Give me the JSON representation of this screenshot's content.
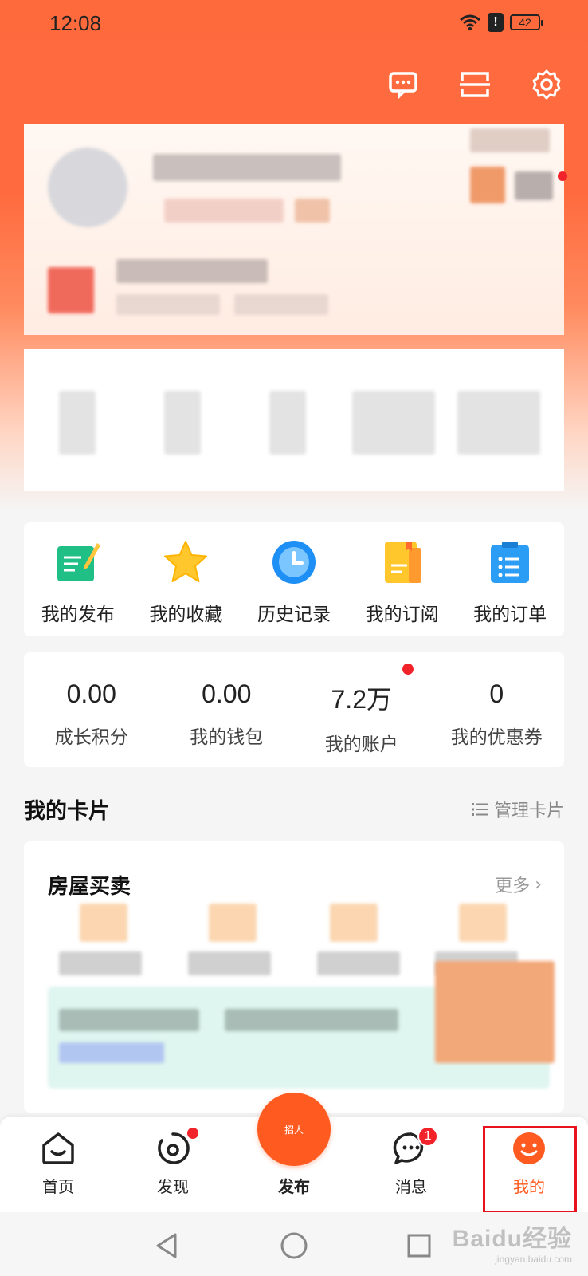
{
  "status_bar": {
    "time": "12:08",
    "alert": "!",
    "battery": "42"
  },
  "quick_actions": [
    {
      "label": "我的发布",
      "icon": "edit-document-icon"
    },
    {
      "label": "我的收藏",
      "icon": "star-icon"
    },
    {
      "label": "历史记录",
      "icon": "clock-icon"
    },
    {
      "label": "我的订阅",
      "icon": "bookmark-folder-icon"
    },
    {
      "label": "我的订单",
      "icon": "order-list-icon"
    }
  ],
  "wallet": [
    {
      "value": "0.00",
      "label": "成长积分"
    },
    {
      "value": "0.00",
      "label": "我的钱包"
    },
    {
      "value": "7.2万",
      "label": "我的账户"
    },
    {
      "value": "0",
      "label": "我的优惠券"
    }
  ],
  "cards_section": {
    "title": "我的卡片",
    "manage_label": "管理卡片"
  },
  "house_card": {
    "title": "房屋买卖",
    "more_label": "更多"
  },
  "tabbar": {
    "items": [
      {
        "label": "首页"
      },
      {
        "label": "发现"
      },
      {
        "label": "发布",
        "inner": "招人"
      },
      {
        "label": "消息",
        "badge": "1"
      },
      {
        "label": "我的"
      }
    ]
  },
  "watermark": {
    "main": "Baidu经验",
    "sub": "jingyan.baidu.com"
  },
  "colors": {
    "accent": "#ff5a1f",
    "badge": "#f2222b",
    "highlight": "#e8121e"
  }
}
